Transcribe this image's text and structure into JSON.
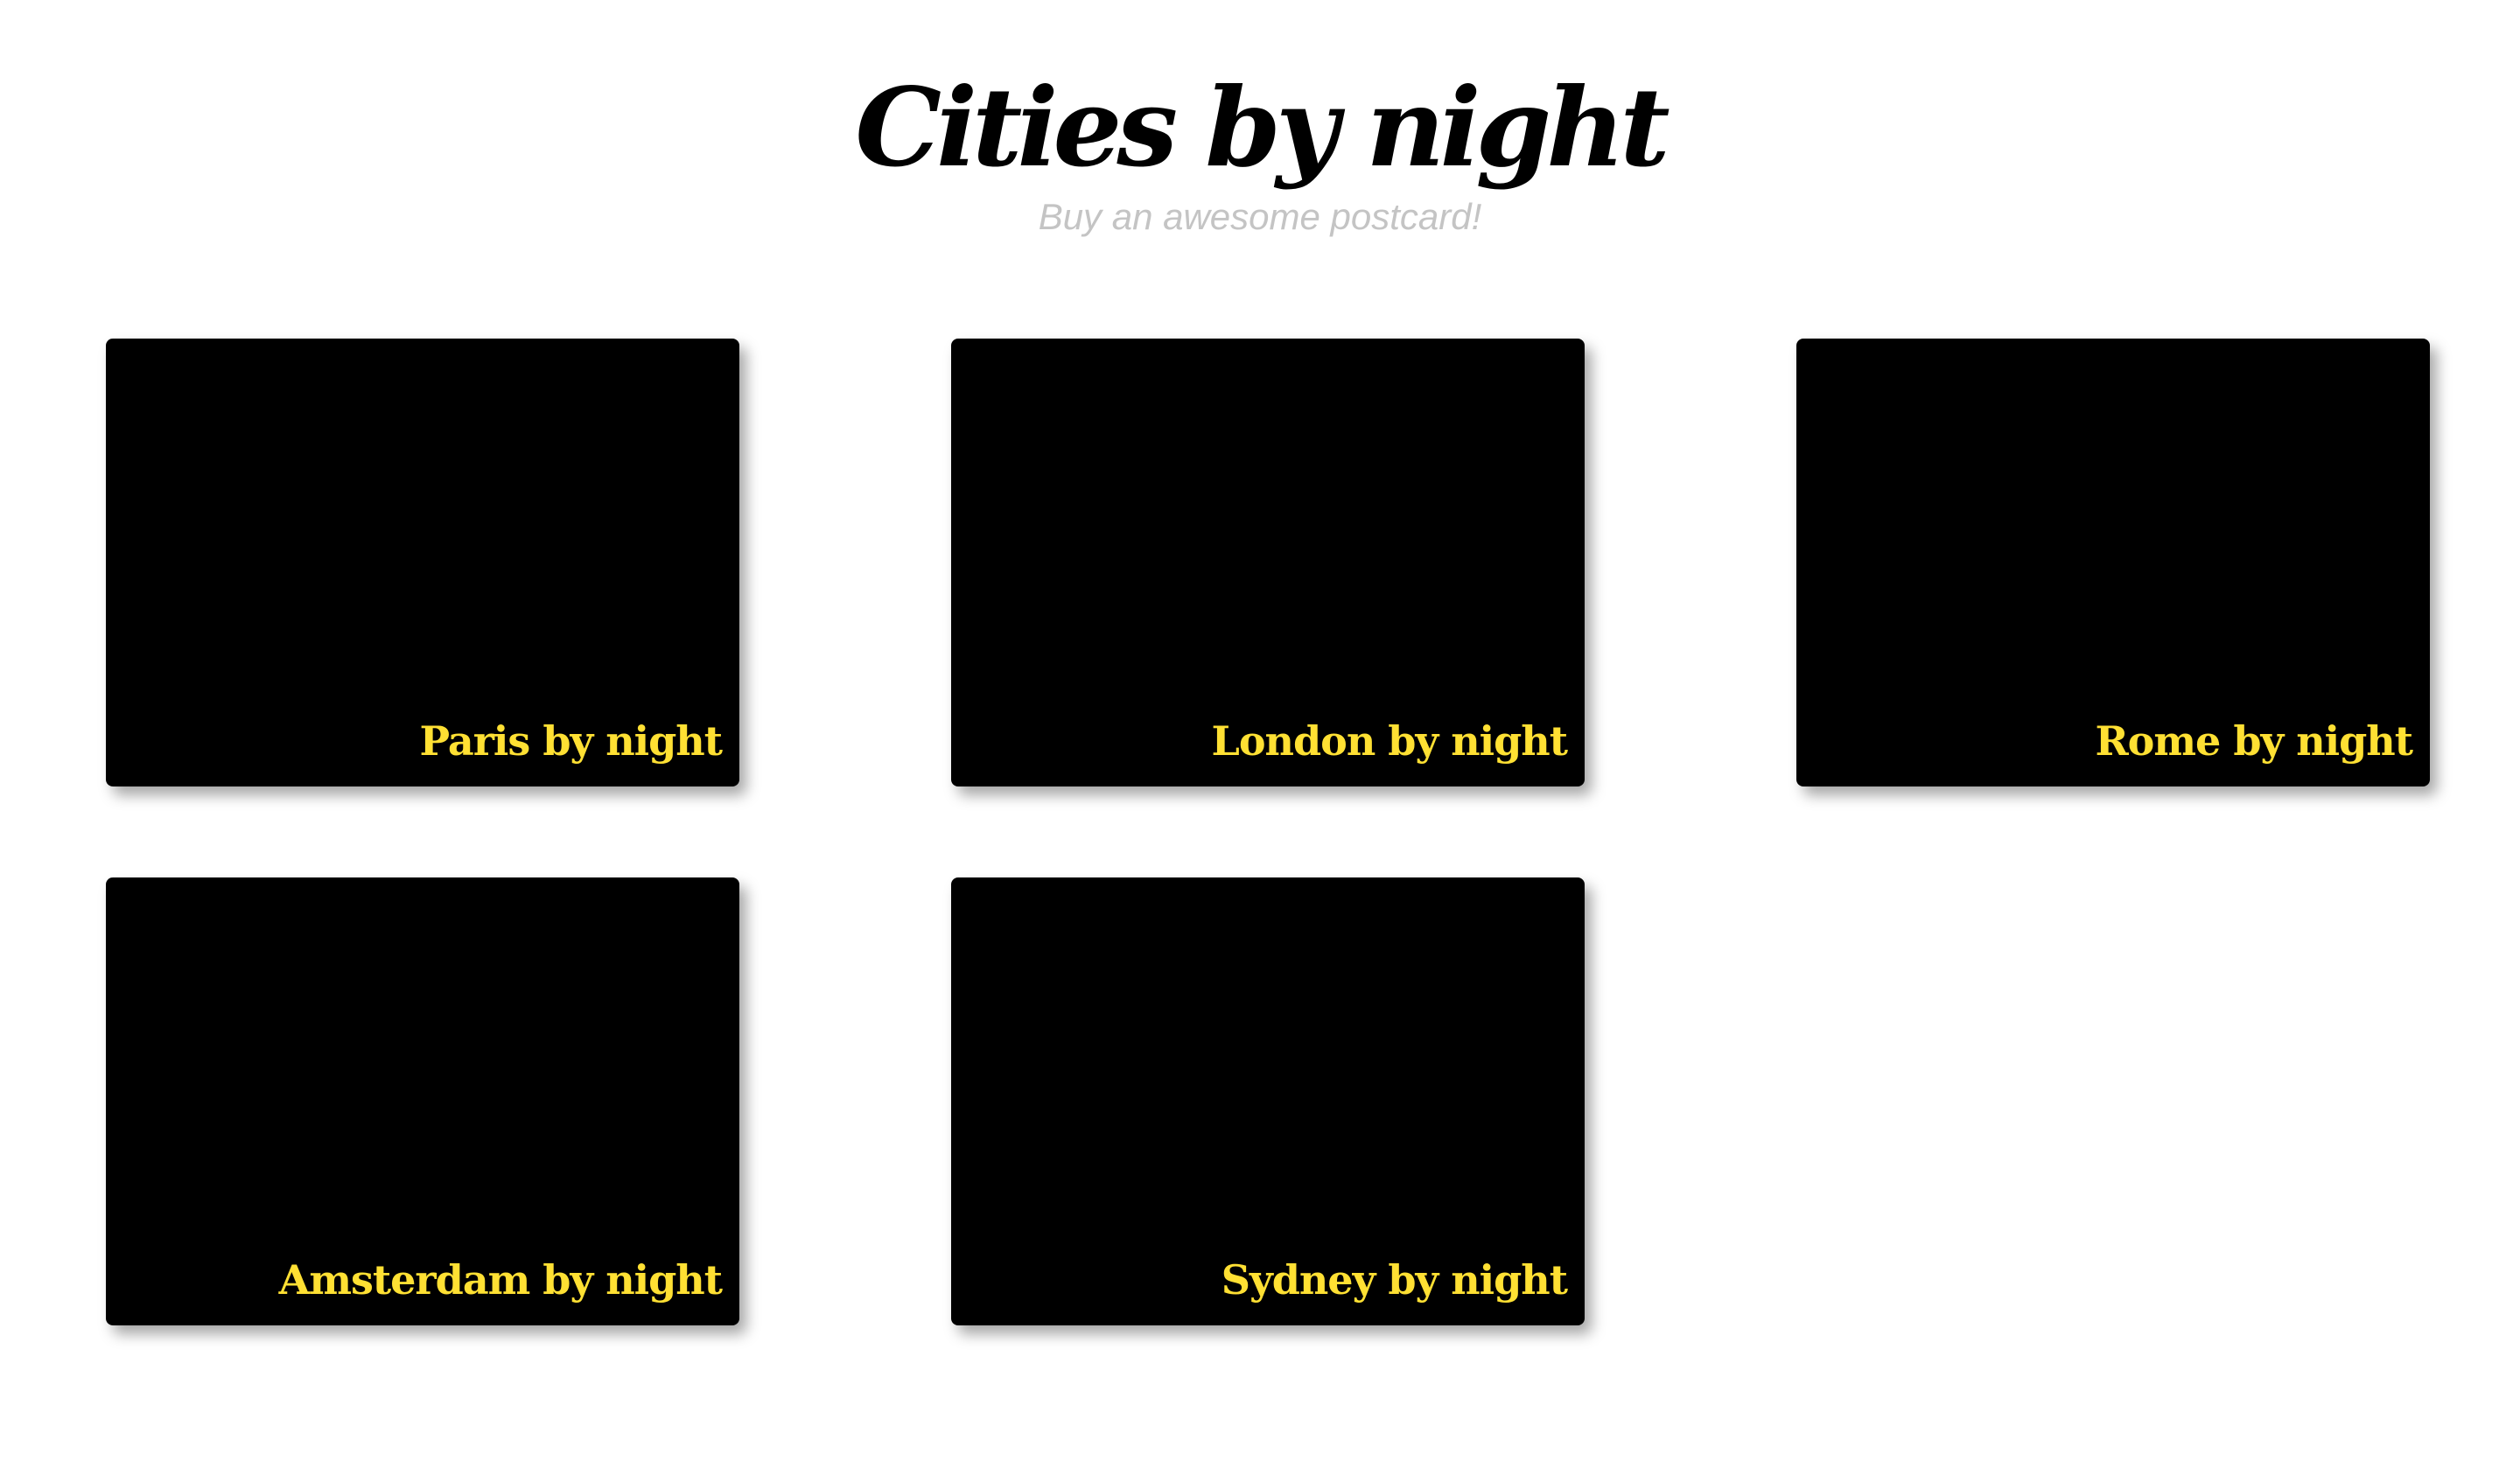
{
  "header": {
    "title": "Cities by night",
    "subtitle": "Buy an awesome postcard!"
  },
  "colors": {
    "caption": "#ffe033",
    "card_background": "#000000",
    "subtitle": "#c4c4c4"
  },
  "postcards": [
    {
      "caption": "Paris by night"
    },
    {
      "caption": "London by night"
    },
    {
      "caption": "Rome by night"
    },
    {
      "caption": "Amsterdam by night"
    },
    {
      "caption": "Sydney by night"
    }
  ]
}
